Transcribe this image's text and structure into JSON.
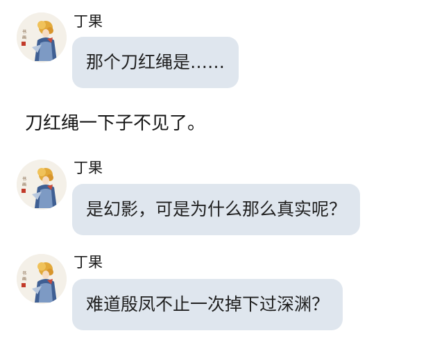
{
  "messages": [
    {
      "sender": "丁果",
      "text": "那个刀红绳是……"
    },
    {
      "sender": "丁果",
      "text": "是幻影，可是为什么那么真实呢？"
    },
    {
      "sender": "丁果",
      "text": "难道殷凤不止一次掉下过深渊？"
    }
  ],
  "narration": "刀红绳一下子不见了。",
  "avatar_icon": "anime-character-avatar-icon",
  "colors": {
    "bubble": "#dfe6ee",
    "text": "#1a1a1a",
    "background": "#ffffff"
  }
}
